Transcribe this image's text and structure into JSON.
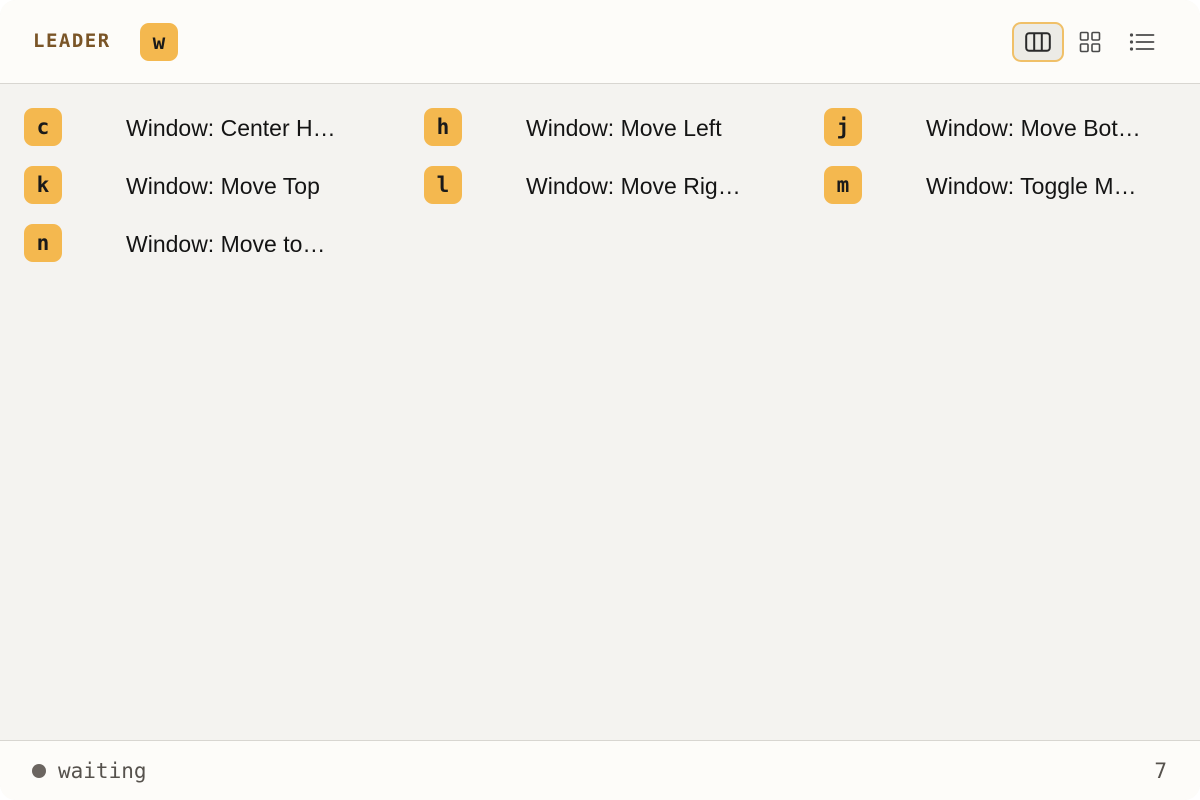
{
  "header": {
    "leader_label": "LEADER",
    "leader_key": "w",
    "views": [
      {
        "icon": "columns-icon",
        "active": true
      },
      {
        "icon": "grid-icon",
        "active": false
      },
      {
        "icon": "list-icon",
        "active": false
      }
    ]
  },
  "items": [
    {
      "key": "c",
      "label": "Window: Center H…"
    },
    {
      "key": "h",
      "label": "Window: Move Left"
    },
    {
      "key": "j",
      "label": "Window: Move Bot…"
    },
    {
      "key": "k",
      "label": "Window: Move Top"
    },
    {
      "key": "l",
      "label": "Window: Move Rig…"
    },
    {
      "key": "m",
      "label": "Window: Toggle M…"
    },
    {
      "key": "n",
      "label": "Window: Move to…"
    }
  ],
  "footer": {
    "status": "waiting",
    "count": "7"
  },
  "colors": {
    "accent": "#f4b84f",
    "leader_text": "#7a5527",
    "status_dot": "#6b6560"
  }
}
